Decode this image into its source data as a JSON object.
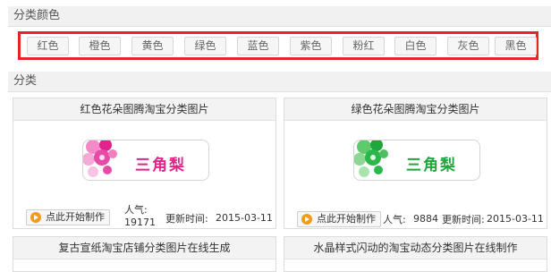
{
  "color_section": {
    "title": "分类颜色",
    "colors": [
      "红色",
      "橙色",
      "黄色",
      "绿色",
      "蓝色",
      "紫色",
      "粉红",
      "白色",
      "灰色",
      "黑色"
    ],
    "highlight_color": "#e8242a"
  },
  "category_section": {
    "title": "分类",
    "cards": [
      {
        "title": "红色花朵图腾淘宝分类图片",
        "banner_text": "三角梨",
        "accent": "#e0248a",
        "make_label": "点此开始制作",
        "popularity_label": "人气:",
        "popularity": "19171",
        "updated_label": "更新时间:",
        "updated": "2015-03-11"
      },
      {
        "title": "绿色花朵图腾淘宝分类图片",
        "banner_text": "三角梨",
        "accent": "#1fa83a",
        "make_label": "点此开始制作",
        "popularity_label": "人气:",
        "popularity": "9884",
        "updated_label": "更新时间:",
        "updated": "2015-03-11"
      },
      {
        "title": "复古宣纸淘宝店铺分类图片在线生成"
      },
      {
        "title": "水晶样式闪动的淘宝动态分类图片在线制作"
      }
    ]
  }
}
